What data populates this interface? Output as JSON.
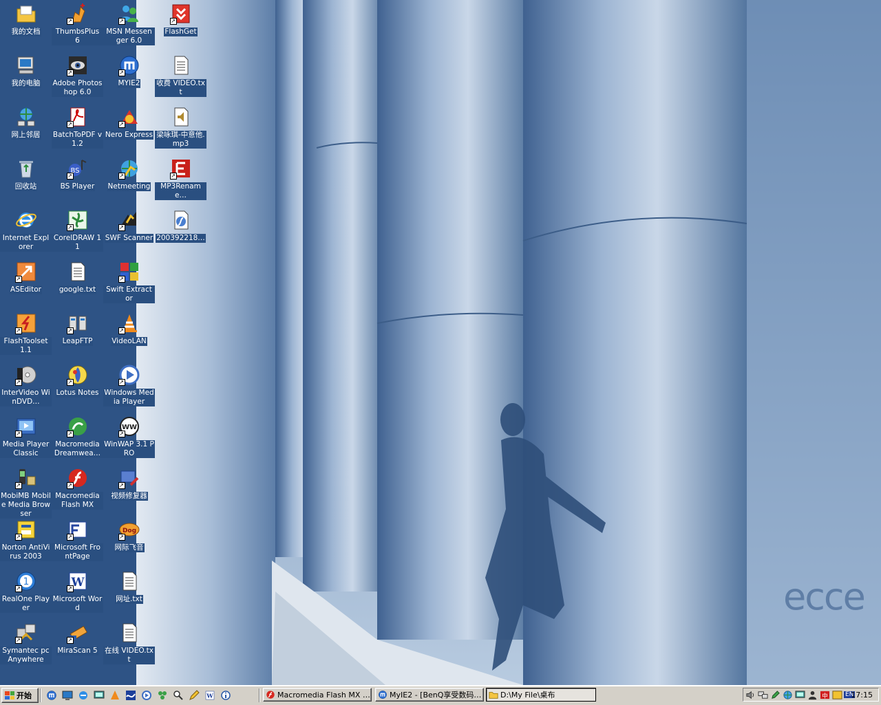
{
  "desktop": {
    "icons": [
      {
        "label": "我的文档",
        "icon": "my-documents-icon",
        "shortcut": false
      },
      {
        "label": "我的电脑",
        "icon": "my-computer-icon",
        "shortcut": false
      },
      {
        "label": "网上邻居",
        "icon": "network-places-icon",
        "shortcut": false
      },
      {
        "label": "回收站",
        "icon": "recycle-bin-icon",
        "shortcut": false
      },
      {
        "label": "Internet Explorer",
        "icon": "internet-explorer-icon",
        "shortcut": false
      },
      {
        "label": "ASEditor",
        "icon": "aseditor-icon",
        "shortcut": true
      },
      {
        "label": "FlashToolset 1.1",
        "icon": "flashtoolset-icon",
        "shortcut": true
      },
      {
        "label": "InterVideo WinDVD…",
        "icon": "windvd-icon",
        "shortcut": true
      },
      {
        "label": "Media Player Classic",
        "icon": "media-player-classic-icon",
        "shortcut": true
      },
      {
        "label": "MobiMB Mobile Media Browser",
        "icon": "mobimb-icon",
        "shortcut": true
      },
      {
        "label": "Norton AntiVirus 2003",
        "icon": "norton-icon",
        "shortcut": true
      },
      {
        "label": "RealOne Player",
        "icon": "realone-icon",
        "shortcut": true
      },
      {
        "label": "Symantec pcAnywhere",
        "icon": "pcanywhere-icon",
        "shortcut": true
      },
      {
        "label": "ThumbsPlus 6",
        "icon": "thumbsplus-icon",
        "shortcut": true
      },
      {
        "label": "Adobe Photoshop 6.0",
        "icon": "photoshop-icon",
        "shortcut": true
      },
      {
        "label": "BatchToPDF v1.2",
        "icon": "batchtopdf-icon",
        "shortcut": true
      },
      {
        "label": "BS Player",
        "icon": "bsplayer-icon",
        "shortcut": true
      },
      {
        "label": "CorelDRAW 11",
        "icon": "coreldraw-icon",
        "shortcut": true
      },
      {
        "label": "google.txt",
        "icon": "text-file-icon",
        "shortcut": false
      },
      {
        "label": "LeapFTP",
        "icon": "leapftp-icon",
        "shortcut": true
      },
      {
        "label": "Lotus Notes",
        "icon": "lotus-notes-icon",
        "shortcut": true
      },
      {
        "label": "Macromedia Dreamwea…",
        "icon": "dreamweaver-icon",
        "shortcut": true
      },
      {
        "label": "Macromedia Flash MX",
        "icon": "flash-mx-icon",
        "shortcut": true
      },
      {
        "label": "Microsoft FrontPage",
        "icon": "frontpage-icon",
        "shortcut": true
      },
      {
        "label": "Microsoft Word",
        "icon": "word-icon",
        "shortcut": true
      },
      {
        "label": "MiraScan 5",
        "icon": "mirascan-icon",
        "shortcut": true
      },
      {
        "label": "MSN Messenger 6.0",
        "icon": "msn-messenger-icon",
        "shortcut": true
      },
      {
        "label": "MYIE2",
        "icon": "myie2-icon",
        "shortcut": true
      },
      {
        "label": "Nero Express",
        "icon": "nero-icon",
        "shortcut": true
      },
      {
        "label": "Netmeeting",
        "icon": "netmeeting-icon",
        "shortcut": true
      },
      {
        "label": "SWF Scanner",
        "icon": "swf-scanner-icon",
        "shortcut": true
      },
      {
        "label": "Swift Extractor",
        "icon": "swift-extractor-icon",
        "shortcut": true
      },
      {
        "label": "VideoLAN",
        "icon": "videolan-icon",
        "shortcut": true
      },
      {
        "label": "Windows Media Player",
        "icon": "windows-media-player-icon",
        "shortcut": true
      },
      {
        "label": "WinWAP 3.1 PRO",
        "icon": "winwap-icon",
        "shortcut": true
      },
      {
        "label": "视频修复器",
        "icon": "video-repair-icon",
        "shortcut": true
      },
      {
        "label": "网际飞音",
        "icon": "netfly-icon",
        "shortcut": true
      },
      {
        "label": "网址.txt",
        "icon": "text-file-icon",
        "shortcut": false
      },
      {
        "label": "在线 VIDEO.txt",
        "icon": "text-file-icon",
        "shortcut": false
      },
      {
        "label": "FlashGet",
        "icon": "flashget-icon",
        "shortcut": true
      },
      {
        "label": "收费 VIDEO.txt",
        "icon": "text-file-icon",
        "shortcut": false
      },
      {
        "label": "梁咏琪-中意他.mp3",
        "icon": "mp3-file-icon",
        "shortcut": false
      },
      {
        "label": "MP3Rename…",
        "icon": "mp3rename-icon",
        "shortcut": true
      },
      {
        "label": "200392218…",
        "icon": "swf-file-icon",
        "shortcut": false
      }
    ]
  },
  "taskbar": {
    "start_label": "开始",
    "quick_launch": [
      "myie2-icon",
      "desktop-icon",
      "ie-icon",
      "monitor-icon",
      "vlc-icon",
      "wave-icon",
      "media-icon",
      "green-icon",
      "search-icon",
      "pencil-icon",
      "word-icon",
      "info-icon"
    ],
    "tasks": [
      {
        "label": "Macromedia Flash MX - [0…",
        "icon": "flash-mx-icon",
        "active": false
      },
      {
        "label": "MyIE2 - [BenQ享受数码…",
        "icon": "myie2-icon",
        "active": false
      },
      {
        "label": "D:\\My File\\桌布",
        "icon": "folder-icon",
        "active": true
      }
    ],
    "tray_icons": [
      "speaker-icon",
      "network-icon",
      "pen-icon",
      "globe-icon",
      "monitor-icon",
      "user-icon",
      "ime-icon",
      "language-icon"
    ],
    "tray_lang": "EN",
    "clock": "17:15"
  },
  "wallpaper": {
    "logo_text": "ecce",
    "colors": {
      "sky": "#8aa8cc",
      "pillar": "#6d8db7",
      "pillar_light": "#c7d6e8",
      "floor": "#dfe6ee"
    }
  }
}
